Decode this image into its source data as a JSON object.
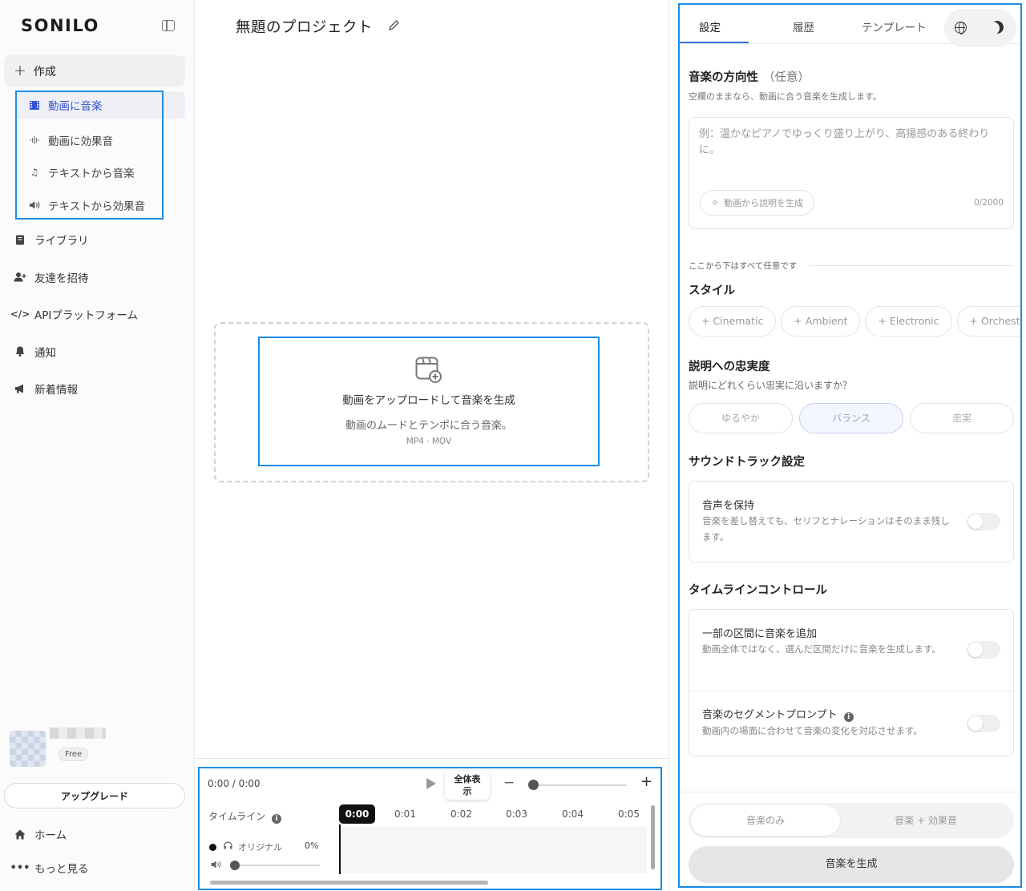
{
  "app": {
    "logo": "SONILO"
  },
  "sidebar": {
    "create_label": "作成",
    "create_items": [
      {
        "label": "動画に音楽",
        "icon": "film-icon"
      },
      {
        "label": "動画に効果音",
        "icon": "waveform-icon"
      },
      {
        "label": "テキストから音楽",
        "icon": "music-note-icon"
      },
      {
        "label": "テキストから効果音",
        "icon": "speaker-icon"
      }
    ],
    "nav_items": [
      {
        "label": "ライブラリ",
        "icon": "book-icon"
      },
      {
        "label": "友達を招待",
        "icon": "add-user-icon"
      },
      {
        "label": "APIプラットフォーム",
        "icon": "code-icon"
      },
      {
        "label": "通知",
        "icon": "bell-icon"
      },
      {
        "label": "新着情報",
        "icon": "megaphone-icon"
      }
    ],
    "user": {
      "plan": "Free"
    },
    "upgrade_label": "アップグレード",
    "bottom_items": [
      {
        "label": "ホーム",
        "icon": "home-icon"
      },
      {
        "label": "もっと見る",
        "icon": "more-icon"
      }
    ]
  },
  "main": {
    "project_title": "無題のプロジェクト",
    "upload": {
      "title": "動画をアップロードして音楽を生成",
      "subtitle": "動画のムードとテンポに合う音楽。",
      "formats": "MP4 · MOV"
    },
    "timeline": {
      "time_readout": "0:00 / 0:00",
      "fit_label_line1": "全体表",
      "fit_label_line2": "示",
      "zoom_minus": "−",
      "zoom_plus": "+",
      "label": "タイムライン",
      "current_time": "0:00",
      "ticks": [
        "0:01",
        "0:02",
        "0:03",
        "0:04",
        "0:05"
      ],
      "track_name": "オリジナル",
      "track_volume": "0%",
      "zoom_level": 0.0
    }
  },
  "panel": {
    "tabs": [
      "設定",
      "履歴",
      "テンプレート"
    ],
    "active_tab": "設定",
    "direction": {
      "title": "音楽の方向性",
      "optional": "（任意）",
      "desc": "空欄のままなら、動画に合う音楽を生成します。",
      "placeholder": "例：温かなピアノでゆっくり盛り上がり、高揚感のある終わりに。",
      "generate_from_video": "動画から説明を生成",
      "char_count": "0/2000"
    },
    "optional_divider": "ここから下はすべて任意です",
    "style": {
      "title": "スタイル",
      "chips": [
        "+ Cinematic",
        "+ Ambient",
        "+ Electronic",
        "+ Orchestral"
      ]
    },
    "fidelity": {
      "title": "説明への忠実度",
      "desc": "説明にどれくらい忠実に沿いますか？",
      "options": [
        "ゆるやか",
        "バランス",
        "忠実"
      ],
      "selected": "バランス"
    },
    "soundtrack": {
      "title": "サウンドトラック設定",
      "keep_voice_title": "音声を保持",
      "keep_voice_desc": "音楽を差し替えても、セリフとナレーションはそのまま残します。"
    },
    "timeline_control": {
      "title": "タイムラインコントロール",
      "partial_title": "一部の区間に音楽を追加",
      "partial_desc": "動画全体ではなく、選んだ区間だけに音楽を生成します。",
      "segment_title": "音楽のセグメントプロンプト",
      "segment_desc": "動画内の場面に合わせて音楽の変化を対応させます。"
    },
    "mode": {
      "options": [
        "音楽のみ",
        "音楽 + 効果音"
      ],
      "selected": "音楽のみ"
    },
    "generate_label": "音楽を生成"
  },
  "colors": {
    "accent": "#3553d1",
    "highlight_box": "#1e8ce6"
  }
}
